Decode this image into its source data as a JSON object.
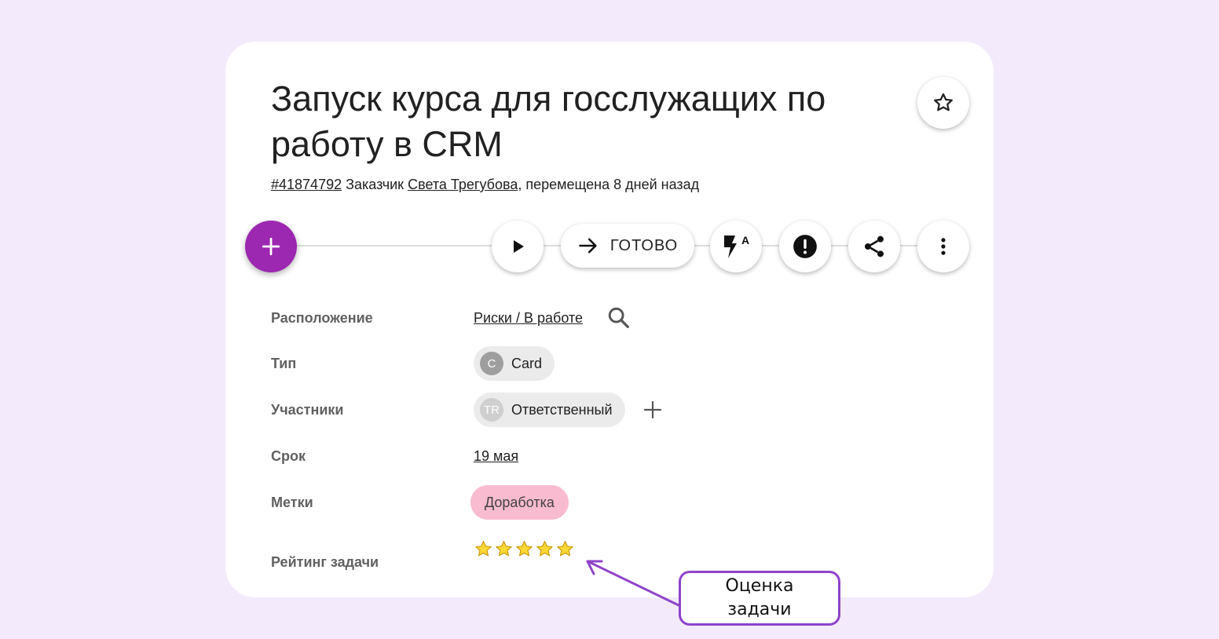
{
  "task": {
    "title": "Запуск курса для госслужащих по работу в CRM",
    "id": "#41874792",
    "customer_prefix": "Заказчик",
    "customer_name": "Света Трегубова",
    "moved_text": ", перемещена 8 дней назад"
  },
  "toolbar": {
    "done_label": "ГОТОВО",
    "automation_badge": "A"
  },
  "fields": {
    "location": {
      "label": "Расположение",
      "value": "Риски / В работе"
    },
    "type": {
      "label": "Тип",
      "avatar": "C",
      "value": "Card"
    },
    "participants": {
      "label": "Участники",
      "avatar": "TR",
      "value": "Ответственный"
    },
    "deadline": {
      "label": "Срок",
      "value": "19 мая"
    },
    "tags": {
      "label": "Метки",
      "value": "Доработка"
    },
    "rating": {
      "label": "Рейтинг задачи",
      "stars": 5,
      "filled": 0
    }
  },
  "callout": {
    "line1": "Оценка",
    "line2": "задачи"
  },
  "colors": {
    "background": "#f3eafc",
    "accent": "#9c27b0",
    "tag": "#f8bbd0",
    "callout_border": "#8e44c9",
    "star": "#fdd835"
  },
  "icons": [
    "star-outline-icon",
    "plus-icon",
    "play-icon",
    "arrow-right-icon",
    "flash-auto-icon",
    "alert-icon",
    "share-icon",
    "more-vert-icon",
    "search-icon",
    "star-icon"
  ]
}
